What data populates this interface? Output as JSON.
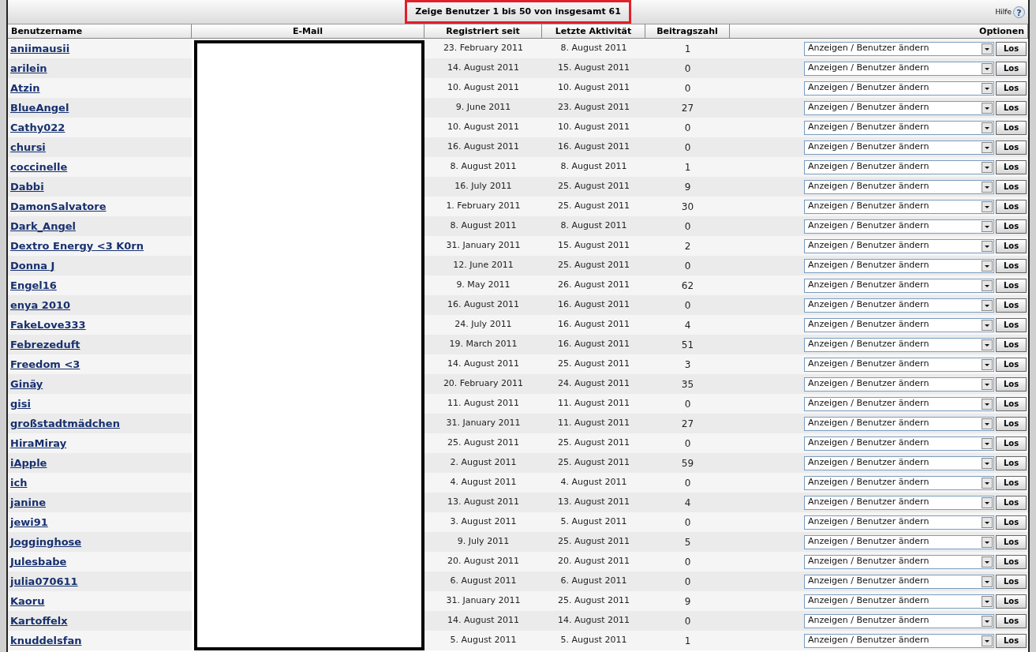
{
  "title": "Zeige Benutzer 1 bis 50 von insgesamt 61",
  "help": {
    "label": "Hilfe",
    "icon": "?"
  },
  "columns": [
    "Benutzername",
    "E-Mail",
    "Registriert seit",
    "Letzte Aktivität",
    "Beitragszahl",
    "Optionen"
  ],
  "rows": [
    {
      "name": "aniimausii",
      "registered": "23. February 2011",
      "last_activity": "8. August 2011",
      "posts": "1",
      "action": "Anzeigen / Benutzer ändern",
      "button": "Los"
    },
    {
      "name": "arilein",
      "registered": "14. August 2011",
      "last_activity": "15. August 2011",
      "posts": "0",
      "action": "Anzeigen / Benutzer ändern",
      "button": "Los"
    },
    {
      "name": "Atzin",
      "registered": "10. August 2011",
      "last_activity": "10. August 2011",
      "posts": "0",
      "action": "Anzeigen / Benutzer ändern",
      "button": "Los"
    },
    {
      "name": "BlueAngel",
      "registered": "9. June 2011",
      "last_activity": "23. August 2011",
      "posts": "27",
      "action": "Anzeigen / Benutzer ändern",
      "button": "Los"
    },
    {
      "name": "Cathy022",
      "registered": "10. August 2011",
      "last_activity": "10. August 2011",
      "posts": "0",
      "action": "Anzeigen / Benutzer ändern",
      "button": "Los"
    },
    {
      "name": "chursi",
      "registered": "16. August 2011",
      "last_activity": "16. August 2011",
      "posts": "0",
      "action": "Anzeigen / Benutzer ändern",
      "button": "Los"
    },
    {
      "name": "coccinelle",
      "registered": "8. August 2011",
      "last_activity": "8. August 2011",
      "posts": "1",
      "action": "Anzeigen / Benutzer ändern",
      "button": "Los"
    },
    {
      "name": "Dabbi",
      "registered": "16. July 2011",
      "last_activity": "25. August 2011",
      "posts": "9",
      "action": "Anzeigen / Benutzer ändern",
      "button": "Los"
    },
    {
      "name": "DamonSalvatore",
      "registered": "1. February 2011",
      "last_activity": "25. August 2011",
      "posts": "30",
      "action": "Anzeigen / Benutzer ändern",
      "button": "Los"
    },
    {
      "name": "Dark_Angel",
      "registered": "8. August 2011",
      "last_activity": "8. August 2011",
      "posts": "0",
      "action": "Anzeigen / Benutzer ändern",
      "button": "Los"
    },
    {
      "name": "Dextro Energy <3 K0rn",
      "registered": "31. January 2011",
      "last_activity": "15. August 2011",
      "posts": "2",
      "action": "Anzeigen / Benutzer ändern",
      "button": "Los"
    },
    {
      "name": "Donna J",
      "registered": "12. June 2011",
      "last_activity": "25. August 2011",
      "posts": "0",
      "action": "Anzeigen / Benutzer ändern",
      "button": "Los"
    },
    {
      "name": "Engel16",
      "registered": "9. May 2011",
      "last_activity": "26. August 2011",
      "posts": "62",
      "action": "Anzeigen / Benutzer ändern",
      "button": "Los"
    },
    {
      "name": "enya 2010",
      "registered": "16. August 2011",
      "last_activity": "16. August 2011",
      "posts": "0",
      "action": "Anzeigen / Benutzer ändern",
      "button": "Los"
    },
    {
      "name": "FakeLove333",
      "registered": "24. July 2011",
      "last_activity": "16. August 2011",
      "posts": "4",
      "action": "Anzeigen / Benutzer ändern",
      "button": "Los"
    },
    {
      "name": "Febrezeduft",
      "registered": "19. March 2011",
      "last_activity": "16. August 2011",
      "posts": "51",
      "action": "Anzeigen / Benutzer ändern",
      "button": "Los"
    },
    {
      "name": "Freedom <3",
      "registered": "14. August 2011",
      "last_activity": "25. August 2011",
      "posts": "3",
      "action": "Anzeigen / Benutzer ändern",
      "button": "Los"
    },
    {
      "name": "Ginäy",
      "registered": "20. February 2011",
      "last_activity": "24. August 2011",
      "posts": "35",
      "action": "Anzeigen / Benutzer ändern",
      "button": "Los"
    },
    {
      "name": "gisi",
      "registered": "11. August 2011",
      "last_activity": "11. August 2011",
      "posts": "0",
      "action": "Anzeigen / Benutzer ändern",
      "button": "Los"
    },
    {
      "name": "großstadtmädchen",
      "registered": "31. January 2011",
      "last_activity": "11. August 2011",
      "posts": "27",
      "action": "Anzeigen / Benutzer ändern",
      "button": "Los"
    },
    {
      "name": "HiraMiray",
      "registered": "25. August 2011",
      "last_activity": "25. August 2011",
      "posts": "0",
      "action": "Anzeigen / Benutzer ändern",
      "button": "Los"
    },
    {
      "name": "iApple",
      "registered": "2. August 2011",
      "last_activity": "25. August 2011",
      "posts": "59",
      "action": "Anzeigen / Benutzer ändern",
      "button": "Los"
    },
    {
      "name": "ich",
      "registered": "4. August 2011",
      "last_activity": "4. August 2011",
      "posts": "0",
      "action": "Anzeigen / Benutzer ändern",
      "button": "Los"
    },
    {
      "name": "janine",
      "registered": "13. August 2011",
      "last_activity": "13. August 2011",
      "posts": "4",
      "action": "Anzeigen / Benutzer ändern",
      "button": "Los"
    },
    {
      "name": "jewi91",
      "registered": "3. August 2011",
      "last_activity": "5. August 2011",
      "posts": "0",
      "action": "Anzeigen / Benutzer ändern",
      "button": "Los"
    },
    {
      "name": "Jogginghose",
      "registered": "9. July 2011",
      "last_activity": "25. August 2011",
      "posts": "5",
      "action": "Anzeigen / Benutzer ändern",
      "button": "Los"
    },
    {
      "name": "Julesbabe",
      "registered": "20. August 2011",
      "last_activity": "20. August 2011",
      "posts": "0",
      "action": "Anzeigen / Benutzer ändern",
      "button": "Los"
    },
    {
      "name": "julia070611",
      "registered": "6. August 2011",
      "last_activity": "6. August 2011",
      "posts": "0",
      "action": "Anzeigen / Benutzer ändern",
      "button": "Los"
    },
    {
      "name": "Kaoru",
      "registered": "31. January 2011",
      "last_activity": "25. August 2011",
      "posts": "9",
      "action": "Anzeigen / Benutzer ändern",
      "button": "Los"
    },
    {
      "name": "Kartoffelx",
      "registered": "14. August 2011",
      "last_activity": "14. August 2011",
      "posts": "0",
      "action": "Anzeigen / Benutzer ändern",
      "button": "Los"
    },
    {
      "name": "knuddelsfan",
      "registered": "5. August 2011",
      "last_activity": "5. August 2011",
      "posts": "1",
      "action": "Anzeigen / Benutzer ändern",
      "button": "Los"
    }
  ]
}
